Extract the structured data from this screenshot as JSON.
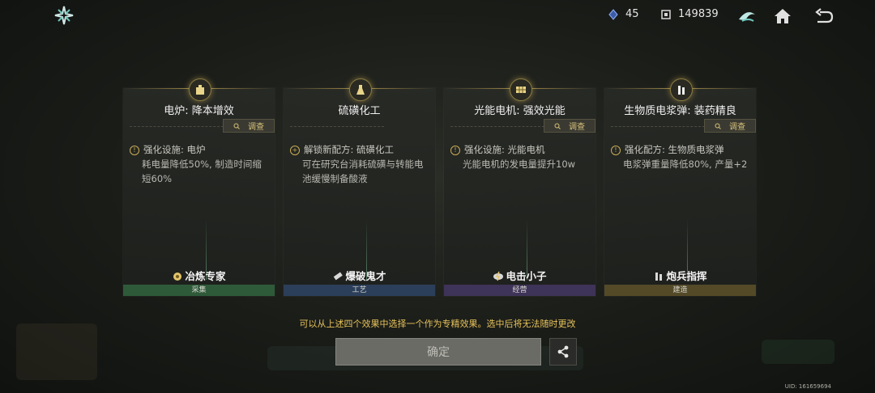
{
  "header": {
    "resource_1": "45",
    "resource_2": "149839",
    "icons": [
      "star-logo-icon",
      "crystal-icon",
      "chip-icon",
      "emblem-icon",
      "home-icon",
      "back-icon"
    ]
  },
  "cards": [
    {
      "title": "电炉: 降本增效",
      "inspect_label": "调查",
      "desc_type": "强化设施: 电炉",
      "desc_body": "耗电量降低50%, 制造时间缩短60%",
      "specialist": "冶炼专家",
      "category": "采集",
      "category_color": "#2f5a3a"
    },
    {
      "title": "硫磺化工",
      "inspect_label": "调查",
      "desc_type": "解锁新配方: 硫磺化工",
      "desc_body": "可在研究台消耗硫磺与转能电池缓慢制备酸液",
      "specialist": "爆破鬼才",
      "category": "工艺",
      "category_color": "#2c3f5a"
    },
    {
      "title": "光能电机: 强效光能",
      "inspect_label": "调查",
      "desc_type": "强化设施: 光能电机",
      "desc_body": "光能电机的发电量提升10w",
      "specialist": "电击小子",
      "category": "经营",
      "category_color": "#3e3358"
    },
    {
      "title": "生物质电浆弹: 装药精良",
      "inspect_label": "调查",
      "desc_type": "强化配方: 生物质电浆弹",
      "desc_body": "电浆弹重量降低80%, 产量+2",
      "specialist": "炮兵指挥",
      "category": "建造",
      "category_color": "#544a28"
    }
  ],
  "notice": "可以从上述四个效果中选择一个作为专精效果。选中后将无法随时更改",
  "confirm_label": "确定",
  "uid": "UID: 161659694"
}
